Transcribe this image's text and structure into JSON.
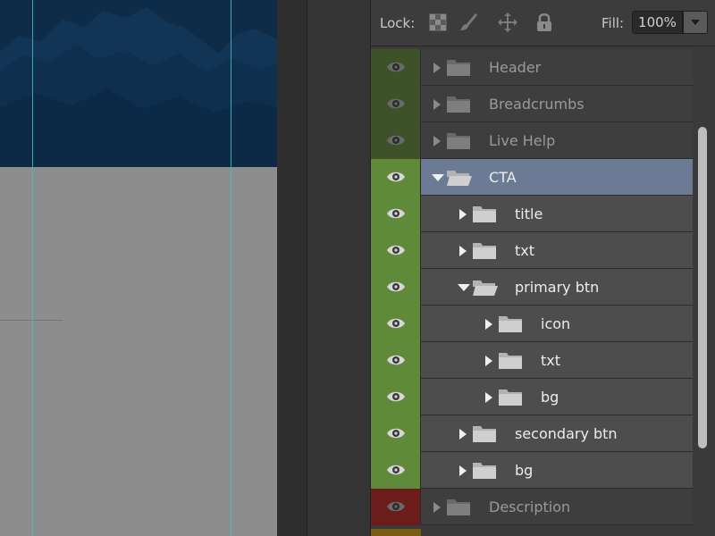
{
  "toolbar": {
    "lock_label": "Lock:",
    "lock_icons": [
      "transparency-lock-icon",
      "brush-lock-icon",
      "move-lock-icon",
      "padlock-icon"
    ],
    "fill_label": "Fill:",
    "fill_value": "100%"
  },
  "layers": [
    {
      "name": "Header",
      "indent": 0,
      "expanded": false,
      "visible_color": "#3d5228",
      "dim": true
    },
    {
      "name": "Breadcrumbs",
      "indent": 0,
      "expanded": false,
      "visible_color": "#3d5228",
      "dim": true
    },
    {
      "name": "Live Help",
      "indent": 0,
      "expanded": false,
      "visible_color": "#3d5228",
      "dim": true
    },
    {
      "name": "CTA",
      "indent": 0,
      "expanded": true,
      "visible_color": "#5e8a3a",
      "selected": true
    },
    {
      "name": "title",
      "indent": 1,
      "expanded": false,
      "visible_color": "#5e8a3a"
    },
    {
      "name": "txt",
      "indent": 1,
      "expanded": false,
      "visible_color": "#5e8a3a"
    },
    {
      "name": "primary btn",
      "indent": 1,
      "expanded": true,
      "visible_color": "#5e8a3a"
    },
    {
      "name": "icon",
      "indent": 2,
      "expanded": false,
      "visible_color": "#5e8a3a"
    },
    {
      "name": "txt",
      "indent": 2,
      "expanded": false,
      "visible_color": "#5e8a3a"
    },
    {
      "name": "bg",
      "indent": 2,
      "expanded": false,
      "visible_color": "#5e8a3a"
    },
    {
      "name": "secondary btn",
      "indent": 1,
      "expanded": false,
      "visible_color": "#5e8a3a"
    },
    {
      "name": "bg",
      "indent": 1,
      "expanded": false,
      "visible_color": "#5e8a3a"
    },
    {
      "name": "Description",
      "indent": 0,
      "expanded": false,
      "visible_color": "#6d1c1c",
      "dim": true
    }
  ],
  "colors": {
    "selected_row": "#6b7b95",
    "hero_blue": "#0d2b47",
    "guide": "#3fbfc6"
  }
}
